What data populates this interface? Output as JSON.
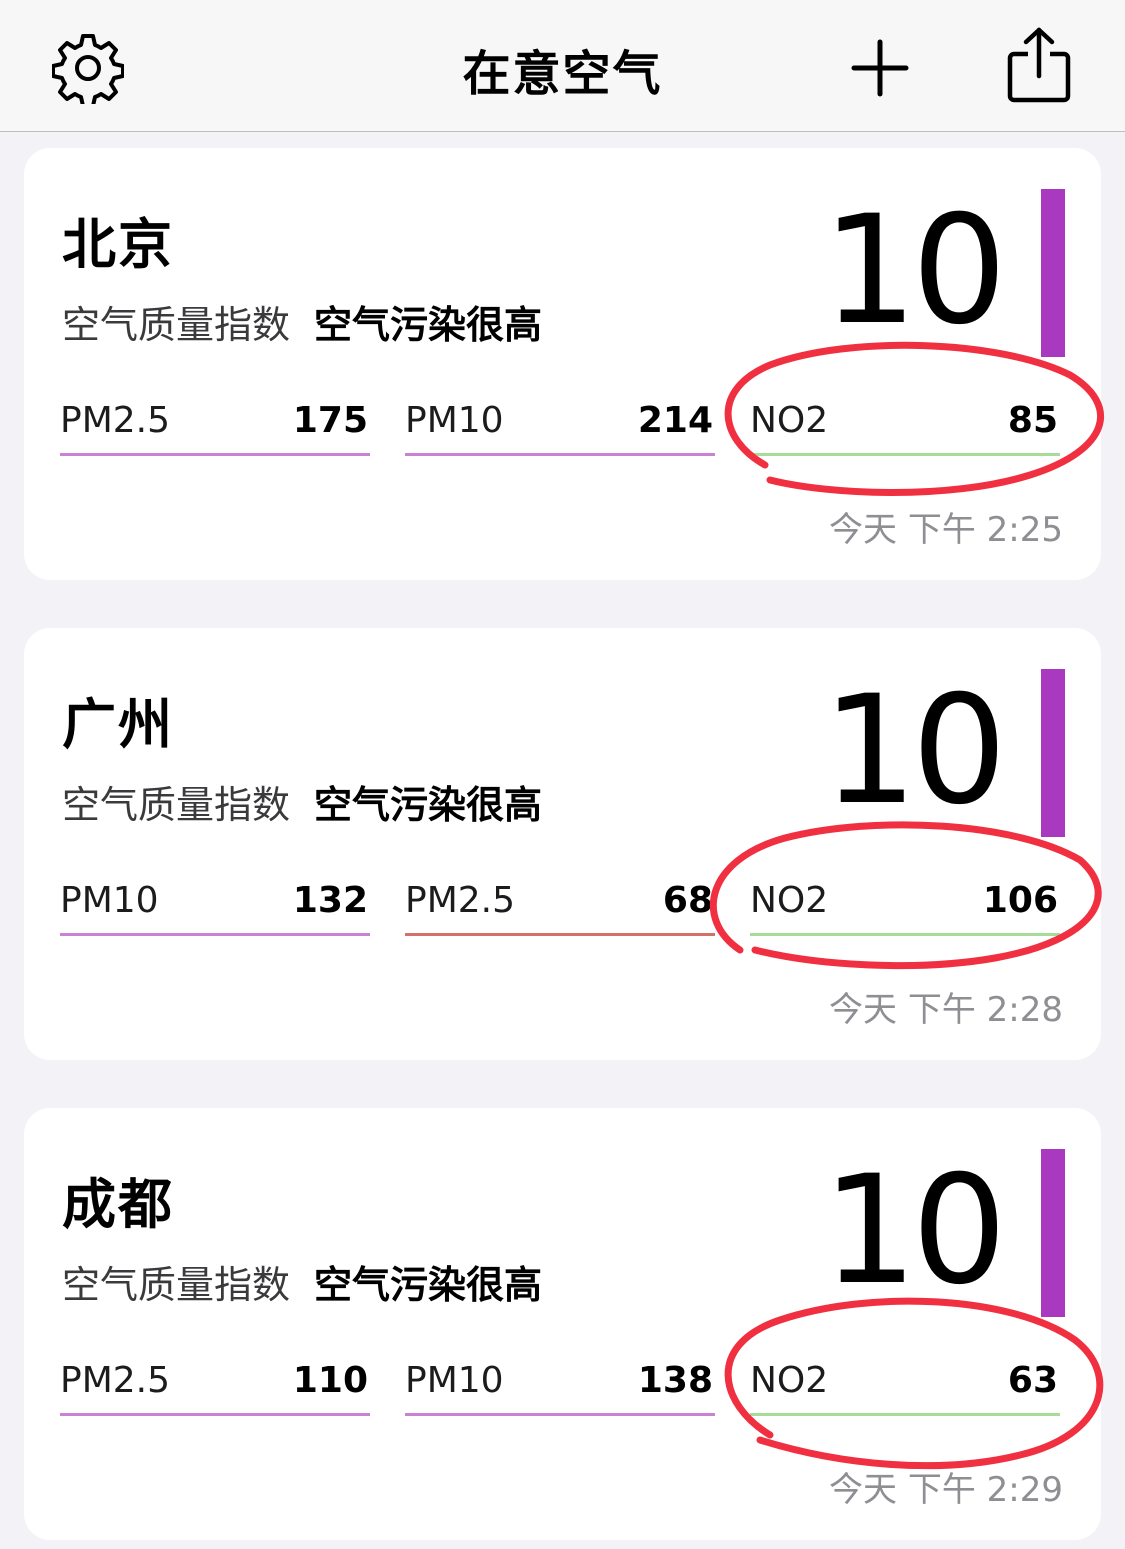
{
  "nav": {
    "title": "在意空气",
    "icons": [
      "gear-icon",
      "plus-icon",
      "share-icon"
    ]
  },
  "colors": {
    "purple": "#a93ac0",
    "pm_line": "#c982d6",
    "red_line": "#d4706a",
    "green_line": "#a8dc9a",
    "annotation": "#f03040"
  },
  "cards": [
    {
      "city": "北京",
      "aqi_label": "空气质量指数",
      "aqi_status": "空气污染很高",
      "aqi_value": "10",
      "pollutants": [
        {
          "name": "PM2.5",
          "value": "175"
        },
        {
          "name": "PM10",
          "value": "214"
        },
        {
          "name": "NO2",
          "value": "85"
        }
      ],
      "time": "今天 下午 2:25"
    },
    {
      "city": "广州",
      "aqi_label": "空气质量指数",
      "aqi_status": "空气污染很高",
      "aqi_value": "10",
      "pollutants": [
        {
          "name": "PM10",
          "value": "132"
        },
        {
          "name": "PM2.5",
          "value": "68"
        },
        {
          "name": "NO2",
          "value": "106"
        }
      ],
      "time": "今天 下午 2:28"
    },
    {
      "city": "成都",
      "aqi_label": "空气质量指数",
      "aqi_status": "空气污染很高",
      "aqi_value": "10",
      "pollutants": [
        {
          "name": "PM2.5",
          "value": "110"
        },
        {
          "name": "PM10",
          "value": "138"
        },
        {
          "name": "NO2",
          "value": "63"
        }
      ],
      "time": "今天 下午 2:29"
    }
  ]
}
